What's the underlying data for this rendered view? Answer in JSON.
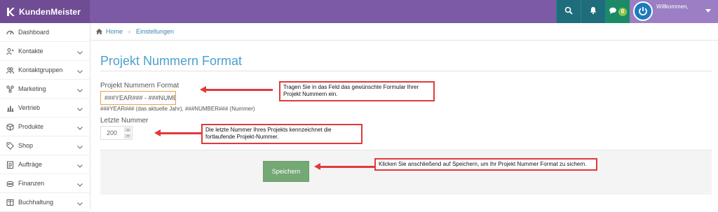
{
  "app": {
    "brand": "KundenMeister"
  },
  "topbar": {
    "notif_badge": "0",
    "welcome": "Willkommen,",
    "colors": {
      "brand_bg": "#6f4c93",
      "bar_bg": "#7d5aa5",
      "teal": "#1f6d7c",
      "green": "#1c8a67"
    }
  },
  "sidebar": {
    "items": [
      {
        "label": "Dashboard",
        "icon": "dashboard-icon"
      },
      {
        "label": "Kontakte",
        "icon": "contacts-icon"
      },
      {
        "label": "Kontaktgruppen",
        "icon": "contact-groups-icon"
      },
      {
        "label": "Marketing",
        "icon": "marketing-icon"
      },
      {
        "label": "Vertrieb",
        "icon": "sales-chart-icon"
      },
      {
        "label": "Produkte",
        "icon": "box-icon"
      },
      {
        "label": "Shop",
        "icon": "tag-icon"
      },
      {
        "label": "Aufträge",
        "icon": "orders-icon"
      },
      {
        "label": "Finanzen",
        "icon": "money-icon"
      },
      {
        "label": "Buchhaltung",
        "icon": "bookkeeping-icon"
      }
    ]
  },
  "breadcrumb": {
    "home": "Home",
    "current": "Einstellungen"
  },
  "page": {
    "title": "Projekt Nummern Format"
  },
  "form": {
    "format_label": "Projekt Nummern Format",
    "format_value": "###YEAR### - ###NUMBER###",
    "format_hint": "###YEAR### (das aktuelle Jahr), ###NUMBER### (Nummer)",
    "last_label": "Letzte Nummer",
    "last_value": "200",
    "save_label": "Speichern"
  },
  "callouts": {
    "c1": "Tragen Sie in das Feld das gewünschte Formular Ihrer Projekt Nummern ein.",
    "c2": "Die letzte Nummer Ihres Projekts kennzeichnet die fortlaufende Projekt-Nummer.",
    "c3": "Klicken Sie anschließend auf Speichern, um Ihr Projekt Nummer Format zu sichern."
  }
}
